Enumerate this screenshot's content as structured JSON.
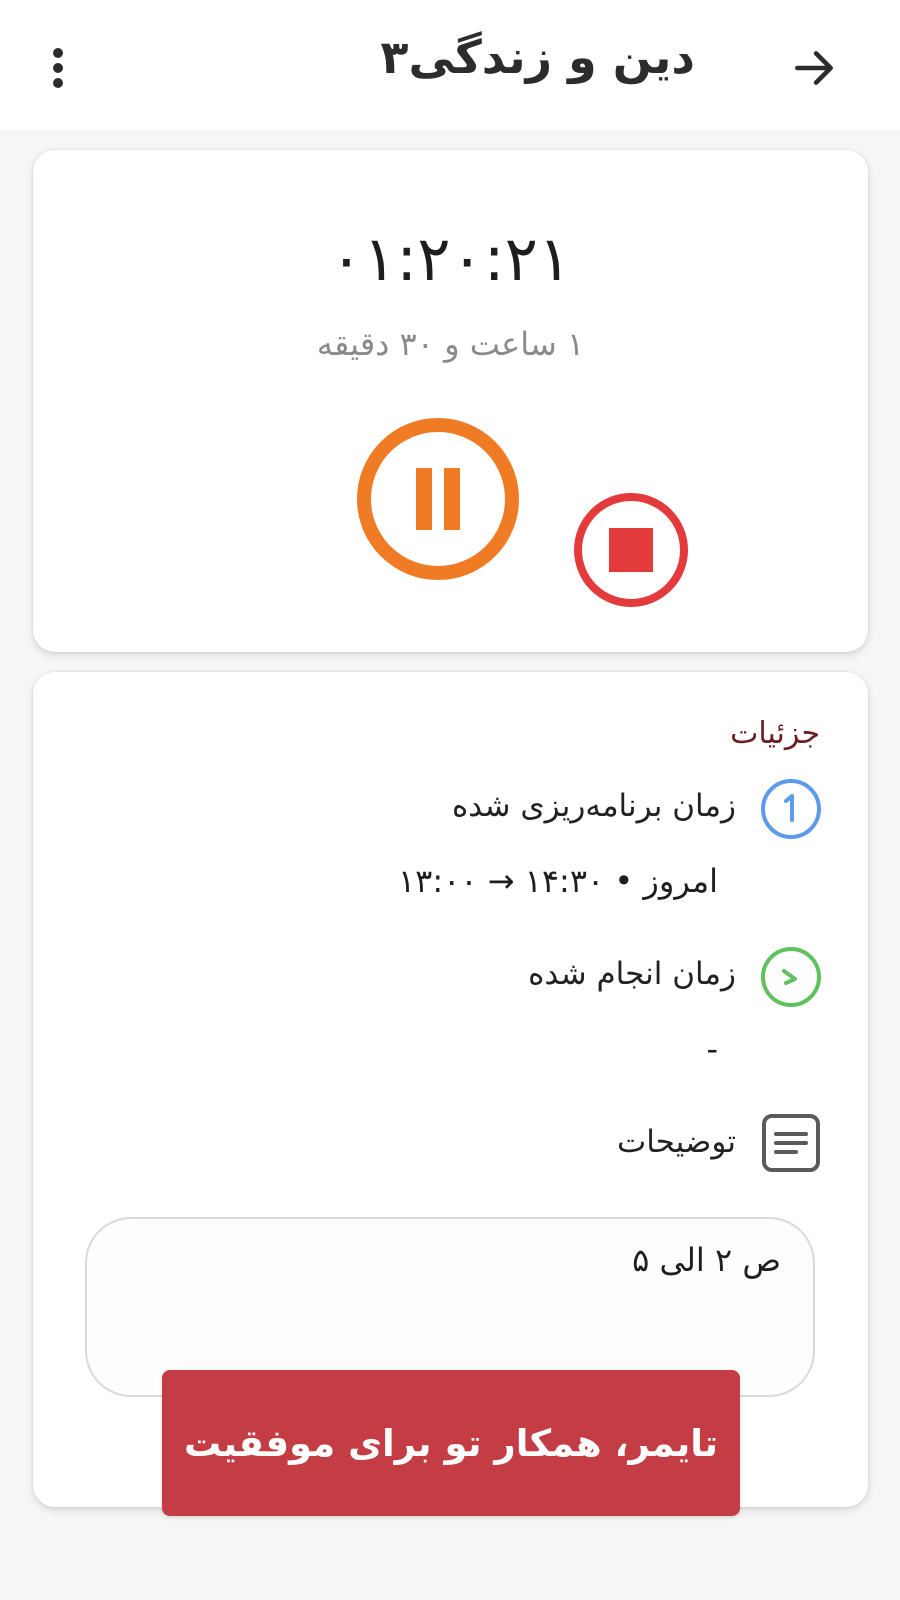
{
  "app_bar": {
    "title": "دین و زندگی۳",
    "back_icon": "arrow-right-icon",
    "menu_icon": "more-vertical-icon"
  },
  "timer": {
    "elapsed": "۰۱:۲۰:۲۱",
    "planned_duration": "۱ ساعت و ۳۰ دقیقه",
    "pause_icon": "pause-icon",
    "stop_icon": "stop-icon",
    "pause_color": "#f07b25",
    "stop_color": "#e33b3b"
  },
  "details": {
    "title": "جزئیات",
    "scheduled": {
      "label": "زمان برنامه‌ریزی شده",
      "value": "امروز • ۱۴:۳۰ → ۱۳:۰۰",
      "icon": "clock-icon",
      "icon_color": "#5b9bea"
    },
    "done": {
      "label": "زمان انجام شده",
      "value": "-",
      "icon": "clock-icon",
      "icon_color": "#5fc25f"
    },
    "notes": {
      "label": "توضیحات",
      "value": "ص ۲ الی ۵",
      "icon": "notes-icon"
    }
  },
  "banner": {
    "text": "تایمر، همکار تو برای موفقیت",
    "color": "#c53d44"
  }
}
